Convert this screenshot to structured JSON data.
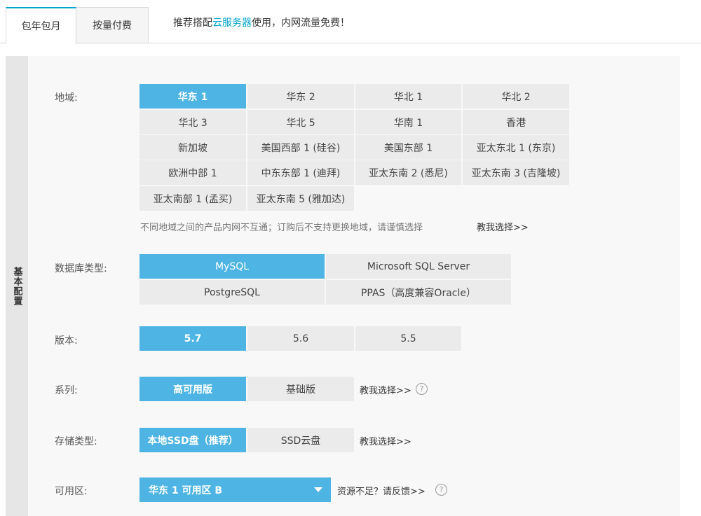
{
  "tabs": {
    "monthly": "包年包月",
    "payg": "按量付费"
  },
  "promo": {
    "prefix": "推荐搭配",
    "link": "云服务器",
    "suffix": "使用，内网流量免费！"
  },
  "sidebar": {
    "label": "基本配置"
  },
  "region": {
    "label": "地域:",
    "options": [
      "华东 1",
      "华东 2",
      "华北 1",
      "华北 2",
      "华北 3",
      "华北 5",
      "华南 1",
      "香港",
      "新加坡",
      "美国西部 1 (硅谷)",
      "美国东部 1",
      "亚太东北 1 (东京)",
      "欧洲中部 1",
      "中东东部 1 (迪拜)",
      "亚太东南 2 (悉尼)",
      "亚太东南 3 (吉隆坡)",
      "亚太南部 1 (孟买)",
      "亚太东南 5 (雅加达)"
    ],
    "selected": "华东 1",
    "hint": "不同地域之间的产品内网不互通；订购后不支持更换地域，请谨慎选择",
    "help_link": "教我选择>>"
  },
  "db_type": {
    "label": "数据库类型:",
    "options": [
      "MySQL",
      "Microsoft SQL Server",
      "PostgreSQL",
      "PPAS（高度兼容Oracle）"
    ],
    "selected": "MySQL"
  },
  "version": {
    "label": "版本:",
    "options": [
      "5.7",
      "5.6",
      "5.5"
    ],
    "selected": "5.7"
  },
  "series": {
    "label": "系列:",
    "options": [
      "高可用版",
      "基础版"
    ],
    "selected": "高可用版",
    "help_link": "教我选择>>",
    "help_icon": "?"
  },
  "storage": {
    "label": "存储类型:",
    "options": [
      "本地SSD盘（推荐）",
      "SSD云盘"
    ],
    "selected": "本地SSD盘（推荐）",
    "help_link": "教我选择>>"
  },
  "zone": {
    "label": "可用区:",
    "value": "华东 1 可用区 B",
    "feedback": "资源不足？请反馈>>",
    "help_icon": "?"
  },
  "colors": {
    "accent": "#4eb4e4",
    "link": "#00a2ca",
    "option_bg": "#ebebeb",
    "panel_bg": "#f8f8f8"
  }
}
